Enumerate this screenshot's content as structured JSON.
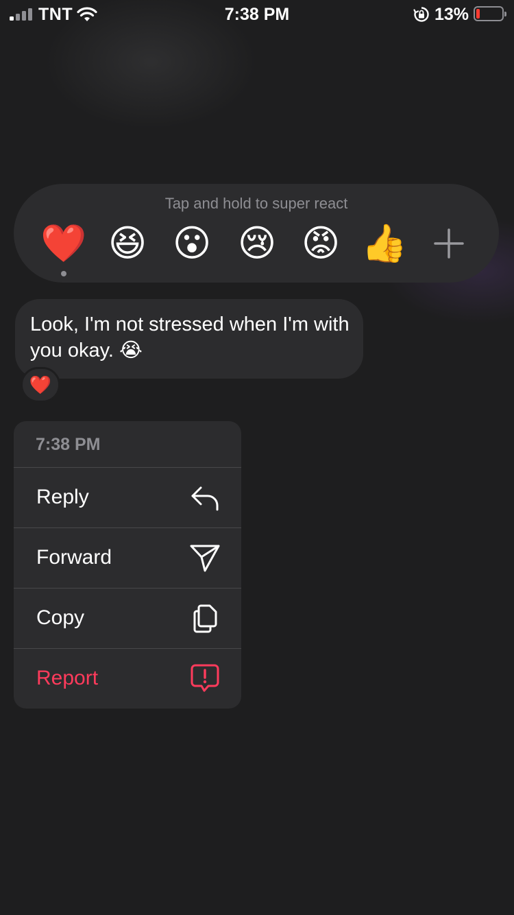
{
  "status_bar": {
    "carrier": "TNT",
    "time": "7:38 PM",
    "battery_percent": "13%",
    "signal_bars_active": 1,
    "signal_bars_total": 4,
    "battery_level": 0.13,
    "battery_color": "#ff3b30"
  },
  "reaction_bar": {
    "hint": "Tap and hold to super react",
    "reactions": [
      {
        "emoji": "❤️",
        "name": "heart",
        "selected": true
      },
      {
        "emoji": "😆",
        "name": "laughing"
      },
      {
        "emoji": "😮",
        "name": "surprised"
      },
      {
        "emoji": "😢",
        "name": "crying"
      },
      {
        "emoji": "😡",
        "name": "angry"
      },
      {
        "emoji": "👍",
        "name": "thumbs-up"
      }
    ],
    "add_label": "+"
  },
  "message": {
    "text": "Look, I'm not stressed when I'm with you okay. 😭",
    "reaction": "❤️"
  },
  "menu": {
    "timestamp": "7:38 PM",
    "items": [
      {
        "label": "Reply",
        "icon": "reply-icon"
      },
      {
        "label": "Forward",
        "icon": "send-icon"
      },
      {
        "label": "Copy",
        "icon": "copy-icon"
      },
      {
        "label": "Report",
        "icon": "report-icon",
        "danger": true
      }
    ],
    "danger_color": "#ff3b5c"
  }
}
